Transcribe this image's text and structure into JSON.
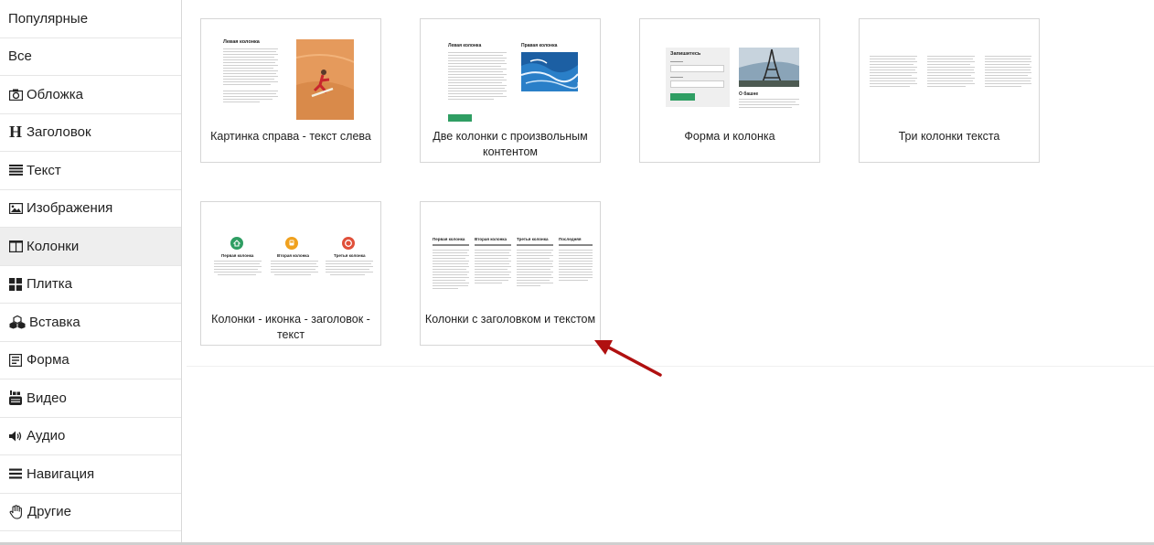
{
  "sidebar": {
    "items": [
      {
        "label": "Популярные",
        "icon": ""
      },
      {
        "label": "Все",
        "icon": ""
      },
      {
        "label": "Обложка",
        "icon": "camera-icon"
      },
      {
        "label": "Заголовок",
        "icon": "heading-icon"
      },
      {
        "label": "Текст",
        "icon": "text-lines-icon"
      },
      {
        "label": "Изображения",
        "icon": "image-icon"
      },
      {
        "label": "Колонки",
        "icon": "columns-icon",
        "active": true
      },
      {
        "label": "Плитка",
        "icon": "tiles-icon"
      },
      {
        "label": "Вставка",
        "icon": "cubes-icon"
      },
      {
        "label": "Форма",
        "icon": "form-icon"
      },
      {
        "label": "Видео",
        "icon": "youtube-icon"
      },
      {
        "label": "Аудио",
        "icon": "speaker-icon"
      },
      {
        "label": "Навигация",
        "icon": "menu-icon"
      },
      {
        "label": "Другие",
        "icon": "hand-icon"
      }
    ]
  },
  "cards": [
    {
      "caption": "Картинка справа - текст слева",
      "thumb": {
        "heading": "Левая колонка"
      }
    },
    {
      "caption": "Две колонки с произвольным контентом",
      "thumb": {
        "left_heading": "Левая колонка",
        "right_heading": "Правая колонка"
      }
    },
    {
      "caption": "Форма и колонка",
      "thumb": {
        "form_title": "Запишитесь",
        "caption_heading": "О башне"
      }
    },
    {
      "caption": "Три колонки текста",
      "thumb": {}
    },
    {
      "caption": "Колонки - иконка - заголовок - текст",
      "thumb": {
        "col1": "Первая колонка",
        "col2": "Вторая колонка",
        "col3": "Третья колонка"
      }
    },
    {
      "caption": "Колонки с заголовком и текстом",
      "thumb": {
        "col1": "Первая колонка",
        "col2": "Вторая колонка",
        "col3": "Третья колонка",
        "col4": "Последняя"
      }
    }
  ],
  "colors": {
    "accent_green": "#2f9e63",
    "arrow": "#b01010",
    "active_bg": "#eeeeee"
  }
}
